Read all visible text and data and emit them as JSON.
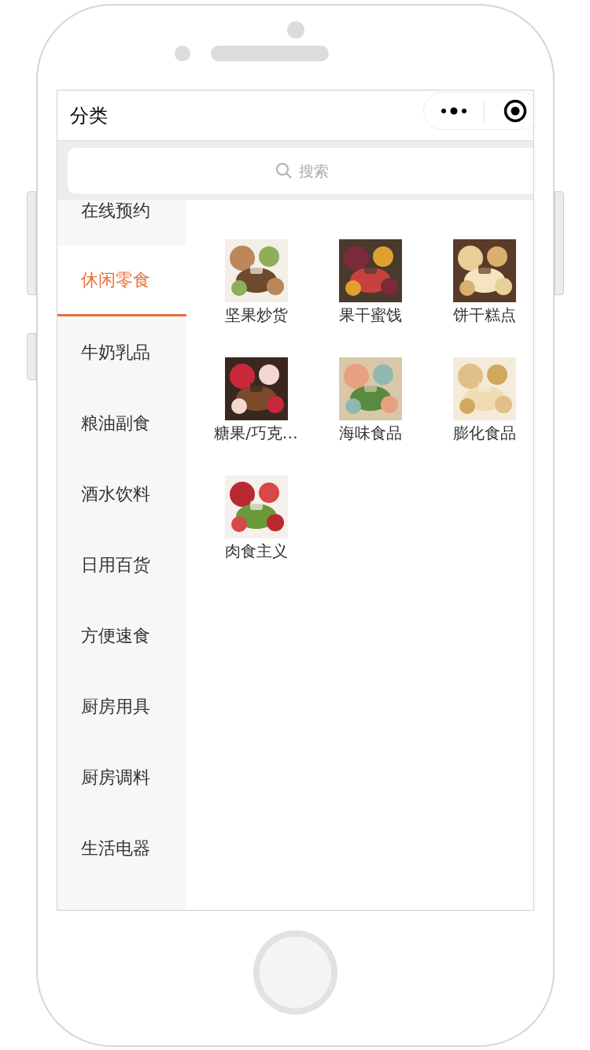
{
  "nav": {
    "title": "分类"
  },
  "search": {
    "placeholder": "搜索"
  },
  "sidebar": {
    "items": [
      {
        "label": "在线预约",
        "selected": false
      },
      {
        "label": "休闲零食",
        "selected": true
      },
      {
        "label": "牛奶乳品",
        "selected": false
      },
      {
        "label": "粮油副食",
        "selected": false
      },
      {
        "label": "酒水饮料",
        "selected": false
      },
      {
        "label": "日用百货",
        "selected": false
      },
      {
        "label": "方便速食",
        "selected": false
      },
      {
        "label": "厨房用具",
        "selected": false
      },
      {
        "label": "厨房调料",
        "selected": false
      },
      {
        "label": "生活电器",
        "selected": false
      }
    ]
  },
  "categories": [
    {
      "label": "坚果炒货"
    },
    {
      "label": "果干蜜饯"
    },
    {
      "label": "饼干糕点"
    },
    {
      "label": "糖果/巧克…"
    },
    {
      "label": "海味食品"
    },
    {
      "label": "膨化食品"
    },
    {
      "label": "肉食主义"
    }
  ]
}
